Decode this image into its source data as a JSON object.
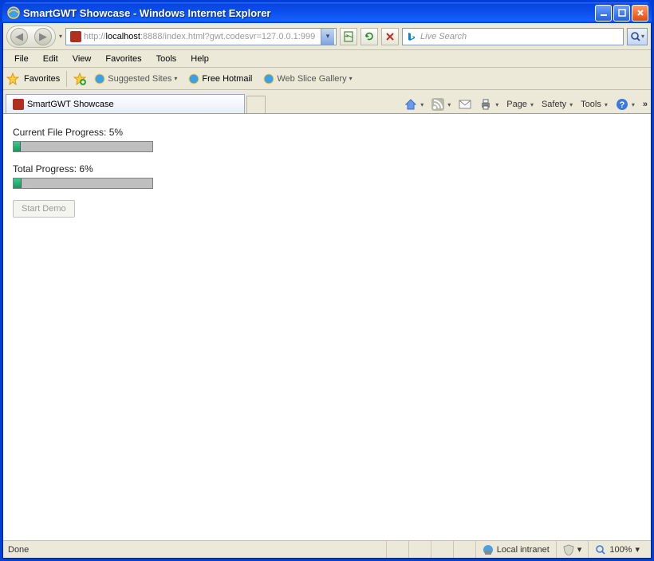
{
  "window": {
    "title": "SmartGWT Showcase - Windows Internet Explorer"
  },
  "nav": {
    "url_prefix": "http://",
    "url_host": "localhost",
    "url_rest": ":8888/index.html?gwt.codesvr=127.0.0.1:999",
    "search_placeholder": "Live Search"
  },
  "menu": [
    "File",
    "Edit",
    "View",
    "Favorites",
    "Tools",
    "Help"
  ],
  "favbar": {
    "favorites": "Favorites",
    "suggested": "Suggested Sites",
    "hotmail": "Free Hotmail",
    "webslice": "Web Slice Gallery"
  },
  "tab": {
    "title": "SmartGWT Showcase"
  },
  "cmdbar": {
    "page": "Page",
    "safety": "Safety",
    "tools": "Tools"
  },
  "page": {
    "file_label_prefix": "Current File Progress: ",
    "file_percent": "5%",
    "file_progress_value": 5,
    "total_label_prefix": "Total Progress: ",
    "total_percent": "6%",
    "total_progress_value": 6,
    "button": "Start Demo"
  },
  "status": {
    "done": "Done",
    "zone": "Local intranet",
    "zoom": "100%"
  }
}
